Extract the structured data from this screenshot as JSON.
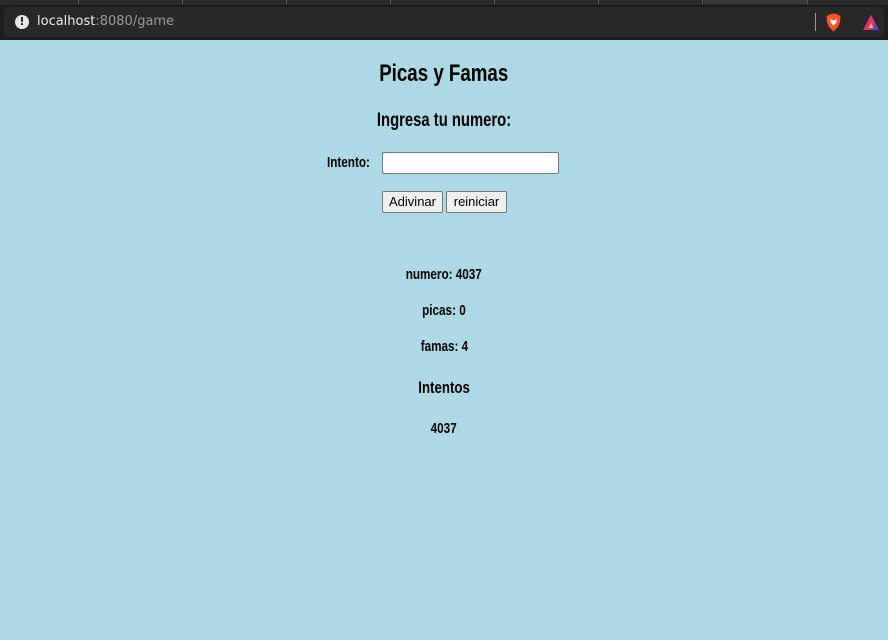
{
  "browser": {
    "url_host": "localhost",
    "url_rest": ":8080/game"
  },
  "game": {
    "title": "Picas y Famas",
    "subtitle": "Ingresa tu numero:",
    "input_label": "Intento:",
    "input_value": "",
    "guess_button": "Adivinar",
    "reset_button": "reiniciar",
    "numero_text": "numero: 4037",
    "picas_text": "picas: 0",
    "famas_text": "famas: 4",
    "intentos_title": "Intentos",
    "intentos": [
      "4037"
    ]
  },
  "colors": {
    "page_background": "#add8e6",
    "brave_orange": "#fb542b"
  }
}
